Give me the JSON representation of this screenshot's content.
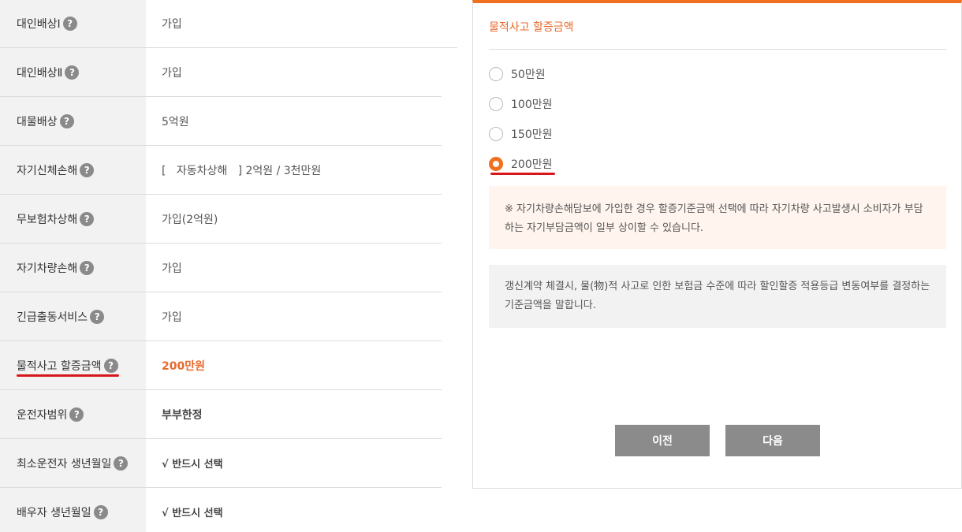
{
  "coverage": [
    {
      "label": "대인배상Ⅰ",
      "value": "가입"
    },
    {
      "label": "대인배상Ⅱ",
      "value": "가입"
    },
    {
      "label": "대물배상",
      "value": "5억원"
    },
    {
      "label": "자기신체손해",
      "value_prefix": "[   자동차상해   ]",
      "value": "2억원 / 3천만원"
    },
    {
      "label": "무보험차상해",
      "value": "가입(2억원)"
    },
    {
      "label": "자기차량손해",
      "value": "가입"
    },
    {
      "label": "긴급출동서비스",
      "value": "가입"
    },
    {
      "label": "물적사고 할증금액",
      "value": "200만원"
    },
    {
      "label": "운전자범위",
      "value": "부부한정"
    },
    {
      "label": "최소운전자 생년월일",
      "value": "√ 반드시 선택"
    },
    {
      "label": "배우자 생년월일",
      "value": "√ 반드시 선택"
    }
  ],
  "help_icon": "?",
  "panel": {
    "title": "물적사고 할증금액",
    "options": [
      "50만원",
      "100만원",
      "150만원",
      "200만원"
    ],
    "selected": "200만원",
    "notice": "※ 자기차량손해담보에 가입한 경우 할증기준금액 선택에 따라 자기차량 사고발생시 소비자가 부담하는 자기부담금액이 일부 상이할 수 있습니다.",
    "description": "갱신계약 체결시, 물(物)적 사고로 인한 보험금 수준에 따라 할인할증 적용등급 변동여부를 결정하는 기준금액을 말합니다.",
    "prev_label": "이전",
    "next_label": "다음"
  },
  "colors": {
    "accent": "#f07020",
    "highlight_text": "#e8692b",
    "underline": "#d8161b",
    "button": "#8b8b8b"
  }
}
